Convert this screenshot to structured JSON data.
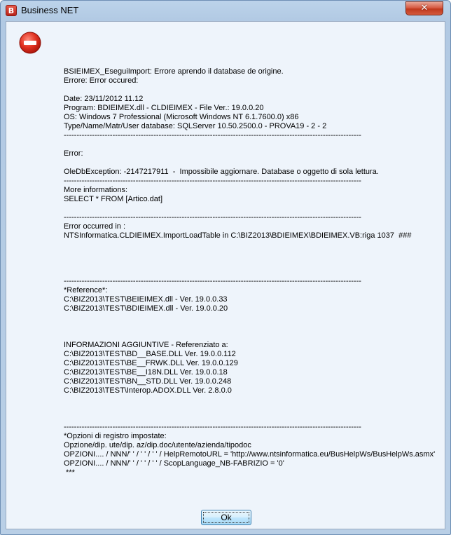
{
  "window": {
    "title": "Business NET",
    "close_glyph": "✕"
  },
  "icons": {
    "app": "app-logo-icon",
    "error": "error-stop-icon"
  },
  "colors": {
    "error_red": "#d8261c",
    "client_bg": "#eef4fb"
  },
  "message": {
    "lines": [
      "BSIEIMEX_EseguiImport: Errore aprendo il database de origine.",
      "Errore: Error occured:",
      "",
      "Date: 23/11/2012 11.12",
      "Program: BDIEIMEX.dll - CLDIEIMEX - File Ver.: 19.0.0.20",
      "OS: Windows 7 Professional (Microsoft Windows NT 6.1.7600.0) x86",
      "Type/Name/Matr/User database: SQLServer 10.50.2500.0 - PROVA19 - 2 - 2",
      "--------------------------------------------------------------------------------------------------------------------",
      "",
      "Error:",
      "",
      "OleDbException: -2147217911  -  Impossibile aggiornare. Database o oggetto di sola lettura.",
      "--------------------------------------------------------------------------------------------------------------------",
      "More informations:",
      "SELECT * FROM [Artico.dat]",
      "",
      "--------------------------------------------------------------------------------------------------------------------",
      "Error occurred in :",
      "NTSInformatica.CLDIEIMEX.ImportLoadTable in C:\\BIZ2013\\BDIEIMEX\\BDIEIMEX.VB:riga 1037  ###",
      "",
      "",
      "",
      "",
      "--------------------------------------------------------------------------------------------------------------------",
      "*Reference*:",
      "C:\\BIZ2013\\TEST\\BEIEIMEX.dll - Ver. 19.0.0.33",
      "C:\\BIZ2013\\TEST\\BDIEIMEX.dll - Ver. 19.0.0.20",
      "",
      "",
      "",
      "INFORMAZIONI AGGIUNTIVE - Referenziato a:",
      "C:\\BIZ2013\\TEST\\BD__BASE.DLL Ver. 19.0.0.112",
      "C:\\BIZ2013\\TEST\\BE__FRWK.DLL Ver. 19.0.0.129",
      "C:\\BIZ2013\\TEST\\BE__I18N.DLL Ver. 19.0.0.18",
      "C:\\BIZ2013\\TEST\\BN__STD.DLL Ver. 19.0.0.248",
      "C:\\BIZ2013\\TEST\\Interop.ADOX.DLL Ver. 2.8.0.0",
      "",
      "",
      "",
      "--------------------------------------------------------------------------------------------------------------------",
      "*Opzioni di registro impostate:",
      "Opzione/dip. ute/dip. az/dip.doc/utente/azienda/tipodoc",
      "OPZIONI.... / NNN/' ' / ' ' / ' ' / HelpRemotoURL = 'http://www.ntsinformatica.eu/BusHelpWs/BusHelpWs.asmx'",
      "OPZIONI.... / NNN/' ' / ' ' / ' ' / ScopLanguage_NB-FABRIZIO = '0'",
      " ***"
    ]
  },
  "buttons": {
    "ok_label": "Ok"
  }
}
